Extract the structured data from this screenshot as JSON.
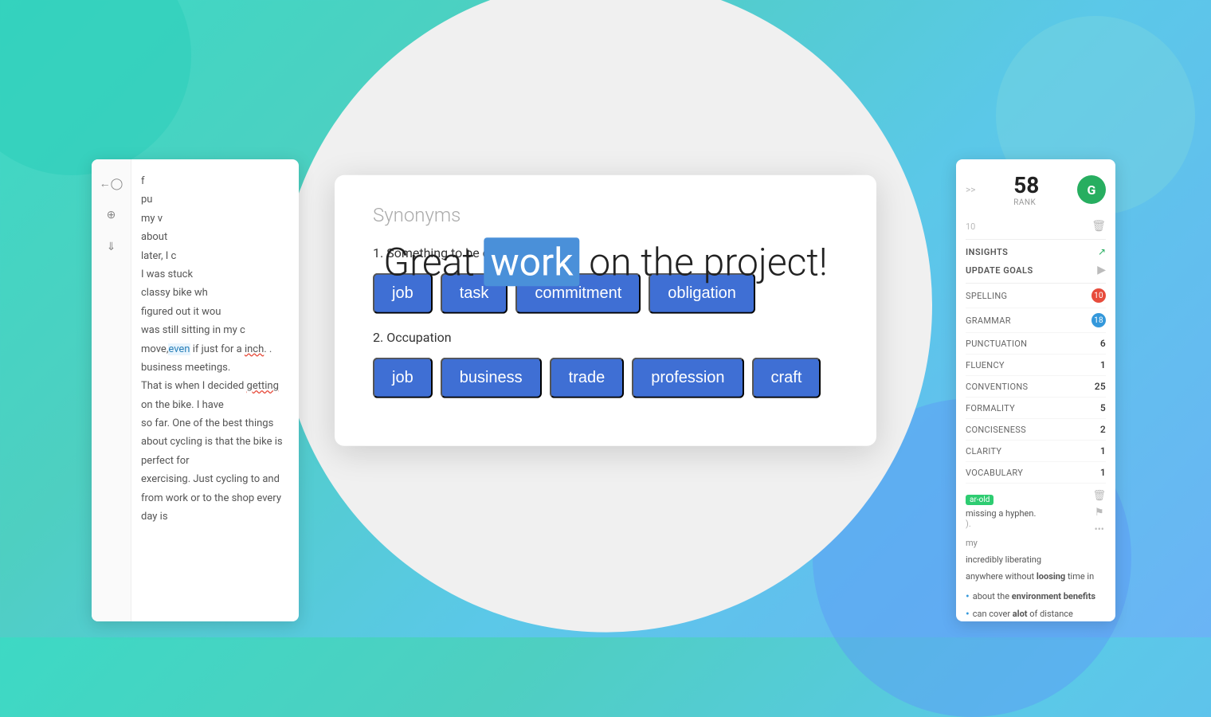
{
  "background": {
    "color_start": "#3dd9c4",
    "color_end": "#6ab4f5"
  },
  "main_title": {
    "before": "Great ",
    "highlight": "work",
    "after": " on the project!"
  },
  "synonyms_card": {
    "title": "Synonyms",
    "sections": [
      {
        "number": "1.",
        "label": "Something to be done",
        "tags": [
          "job",
          "task",
          "commitment",
          "obligation"
        ]
      },
      {
        "number": "2.",
        "label": "Occupation",
        "tags": [
          "job",
          "business",
          "trade",
          "profession",
          "craft"
        ]
      }
    ]
  },
  "left_panel": {
    "text_lines": [
      "f",
      "pu",
      "my v",
      "about",
      "later, I c",
      "I was stuck",
      "classy bike wh",
      "figured out it wou",
      "was still sitting in my c",
      "move, even if just for a inch. .",
      "business meetings.",
      "That is when I decided getting on the bike. I have",
      "so far. One of the best things about cycling is that the bike is perfect for",
      "exercising. Just cycling to and from work or to the shop every day is"
    ]
  },
  "right_panel": {
    "score": "58",
    "rank_label": "RANK",
    "expand_label": ">>",
    "count_label": "10",
    "insights_label": "INSIGHTS",
    "update_goals_label": "UPDATE GOALS",
    "metrics": [
      {
        "label": "SPELLING",
        "value": "10",
        "type": "badge-red"
      },
      {
        "label": "GRAMMAR",
        "value": "18",
        "type": "badge-blue"
      },
      {
        "label": "PUNCTUATION",
        "value": "6",
        "type": "number"
      },
      {
        "label": "FLUENCY",
        "value": "1",
        "type": "number"
      },
      {
        "label": "CONVENTIONS",
        "value": "25",
        "type": "number"
      },
      {
        "label": "FORMALITY",
        "value": "5",
        "type": "number"
      },
      {
        "label": "CONCISENESS",
        "value": "2",
        "type": "number"
      },
      {
        "label": "CLARITY",
        "value": "1",
        "type": "number"
      },
      {
        "label": "VOCABULARY",
        "value": "1",
        "type": "number"
      }
    ],
    "alert_tag": "ar-old",
    "alert_text": "missing a hyphen.",
    "alert_sub": ").",
    "ellipsis": "...",
    "bullets": [
      {
        "text": "about the ",
        "bold": "environment benefits"
      },
      {
        "text": "can cover ",
        "bold": "alot",
        "after": " of distance"
      }
    ]
  }
}
